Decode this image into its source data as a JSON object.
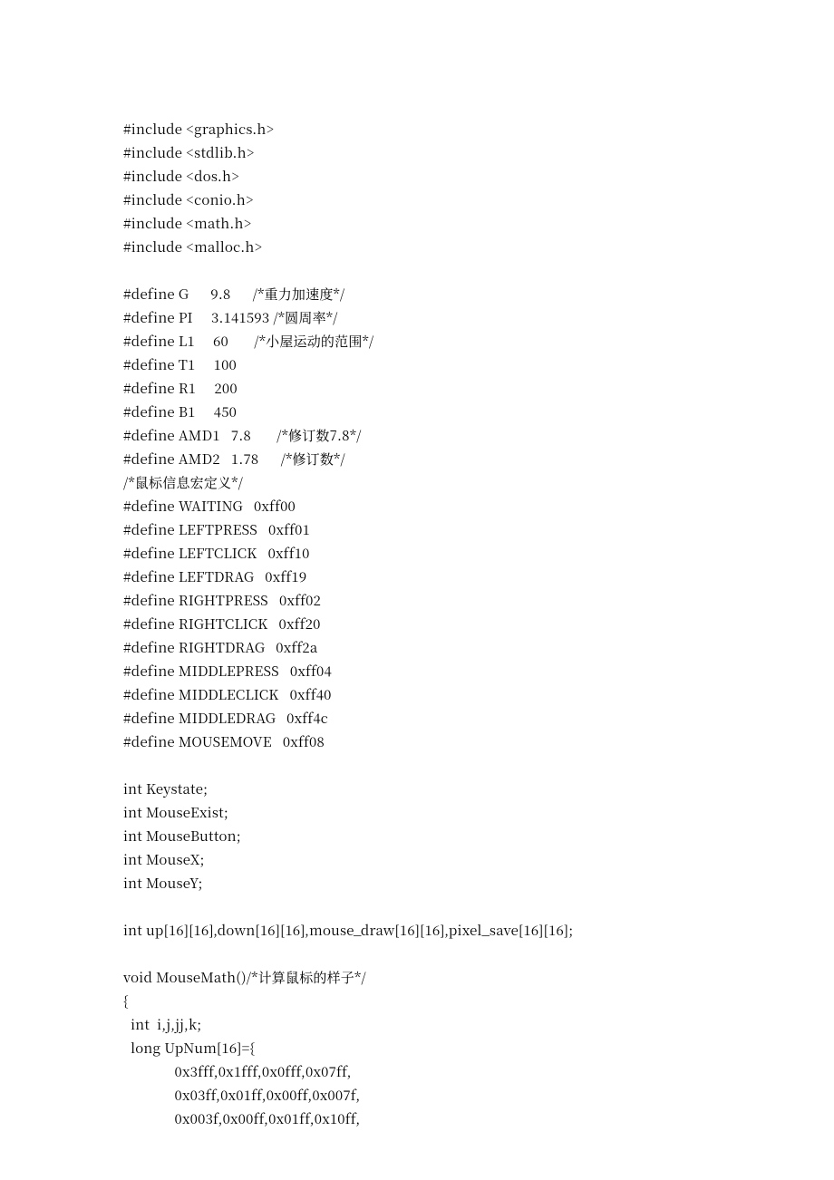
{
  "code_lines": [
    "#include <graphics.h>",
    "#include <stdlib.h>",
    "#include <dos.h>",
    "#include <conio.h>",
    "#include <math.h>",
    "#include <malloc.h>",
    "",
    "#define G      9.8      /*重力加速度*/",
    "#define PI     3.141593 /*圆周率*/",
    "#define L1     60       /*小屋运动的范围*/",
    "#define T1     100",
    "#define R1     200",
    "#define B1     450",
    "#define AMD1   7.8       /*修订数7.8*/",
    "#define AMD2   1.78      /*修订数*/",
    "/*鼠标信息宏定义*/",
    "#define WAITING   0xff00",
    "#define LEFTPRESS   0xff01",
    "#define LEFTCLICK   0xff10",
    "#define LEFTDRAG   0xff19",
    "#define RIGHTPRESS   0xff02",
    "#define RIGHTCLICK   0xff20",
    "#define RIGHTDRAG   0xff2a",
    "#define MIDDLEPRESS   0xff04",
    "#define MIDDLECLICK   0xff40",
    "#define MIDDLEDRAG   0xff4c",
    "#define MOUSEMOVE   0xff08",
    "",
    "int Keystate;",
    "int MouseExist;",
    "int MouseButton;",
    "int MouseX;",
    "int MouseY;",
    "",
    "int up[16][16],down[16][16],mouse_draw[16][16],pixel_save[16][16];",
    "",
    "void MouseMath()/*计算鼠标的样子*/",
    "{",
    "  int  i,j,jj,k;",
    "  long UpNum[16]={",
    "              0x3fff,0x1fff,0x0fff,0x07ff,",
    "              0x03ff,0x01ff,0x00ff,0x007f,",
    "              0x003f,0x00ff,0x01ff,0x10ff,"
  ]
}
